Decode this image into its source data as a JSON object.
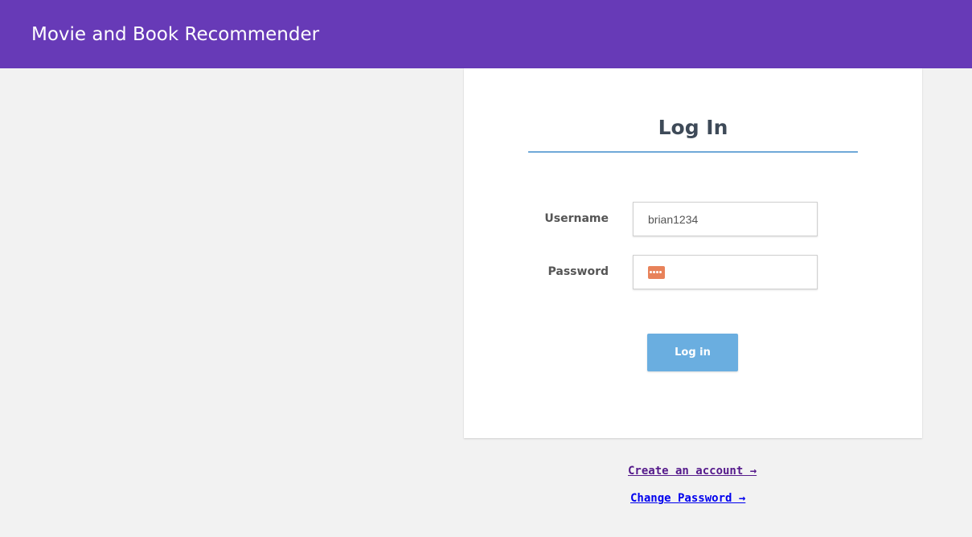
{
  "header": {
    "app_title": "Movie and Book Recommender",
    "bg_color": "#673ab7"
  },
  "login_card": {
    "title": "Log In",
    "username": {
      "label": "Username",
      "value": "brian1234"
    },
    "password": {
      "label": "Password",
      "value": "",
      "autofill_icon": "password-key-icon"
    },
    "submit_label": "Log in",
    "submit_color": "#6aaee0"
  },
  "links": {
    "create_account": "Create an account →",
    "change_password": "Change Password →"
  }
}
